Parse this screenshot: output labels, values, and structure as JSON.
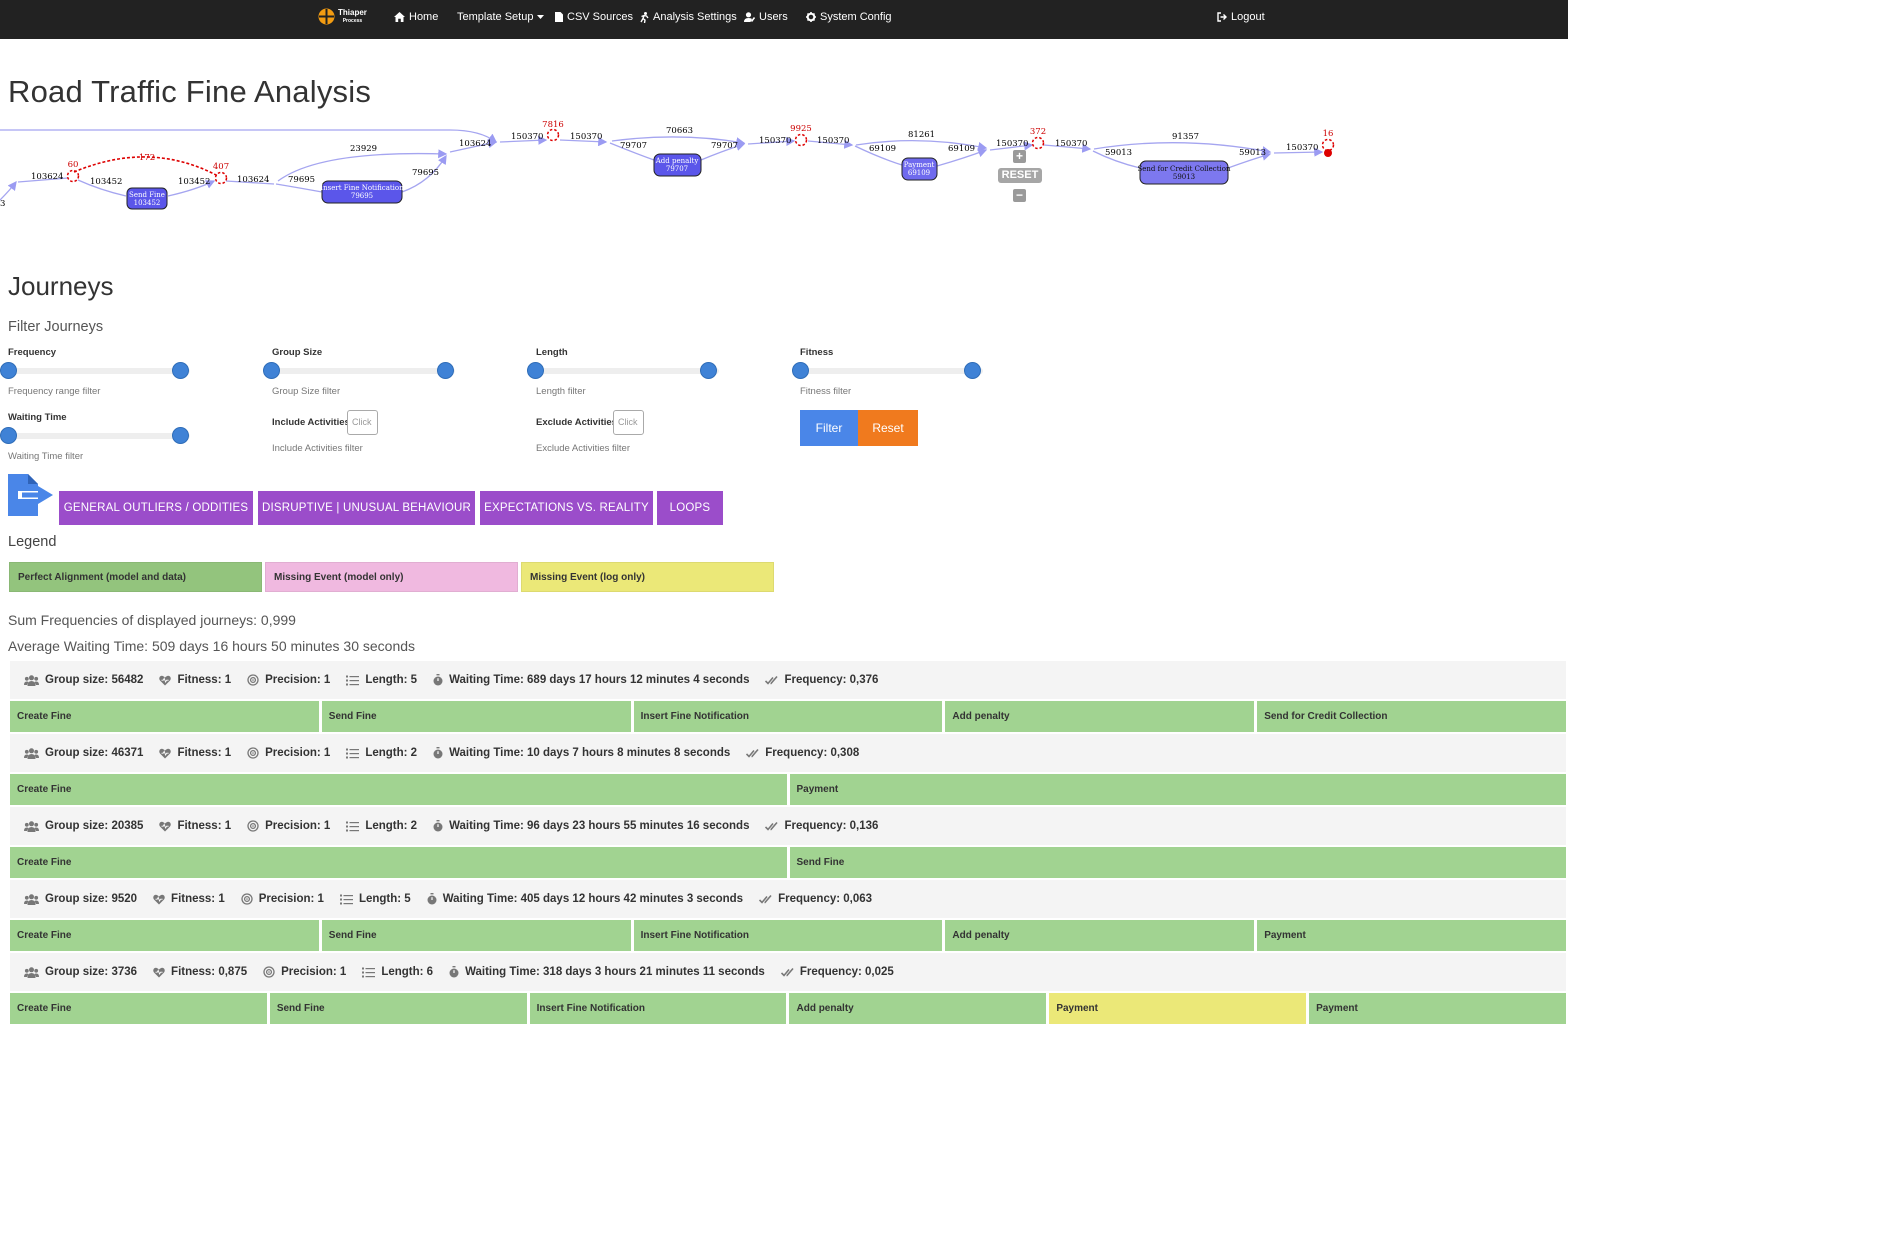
{
  "navbar": {
    "brand_name": "Thiaper",
    "brand_sub": "Process",
    "home": "Home",
    "template_setup": "Template Setup",
    "csv_sources": "CSV Sources",
    "analysis_settings": "Analysis Settings",
    "users": "Users",
    "system_config": "System Config",
    "logout": "Logout"
  },
  "page": {
    "title": "Road Traffic Fine Analysis"
  },
  "graph": {
    "nodes": [
      {
        "label": "Send Fine",
        "count": "103452"
      },
      {
        "label": "Insert Fine Notification",
        "count": "79695"
      },
      {
        "label": "Add penalty",
        "count": "79707"
      },
      {
        "label": "Payment",
        "count": "69109"
      },
      {
        "label": "Send for Credit Collection",
        "count": "59013"
      }
    ],
    "edge_labels": [
      "103624",
      "103452",
      "103452",
      "103624",
      "79695",
      "79695",
      "23929",
      "103624",
      "150370",
      "150370",
      "79707",
      "70663",
      "79707",
      "150370",
      "150370",
      "69109",
      "81261",
      "69109",
      "150370",
      "150370",
      "59013",
      "91357",
      "59013",
      "150370",
      "3"
    ],
    "event_counts": [
      "60",
      "172",
      "407",
      "7816",
      "9925",
      "372",
      "16"
    ],
    "reset_label": "RESET",
    "zoom_in": "+",
    "zoom_out": "−"
  },
  "journeys_section": {
    "title": "Journeys",
    "filter_heading": "Filter Journeys"
  },
  "filters": {
    "frequency": {
      "label": "Frequency",
      "help": "Frequency range filter",
      "range": [
        0,
        1
      ]
    },
    "group_size": {
      "label": "Group Size",
      "help": "Group Size filter",
      "range": [
        0,
        1
      ]
    },
    "length": {
      "label": "Length",
      "help": "Length filter",
      "range": [
        0,
        1
      ]
    },
    "fitness": {
      "label": "Fitness",
      "help": "Fitness filter",
      "range": [
        0,
        1
      ]
    },
    "waiting_time": {
      "label": "Waiting Time",
      "help": "Waiting Time filter",
      "range": [
        0,
        1
      ]
    },
    "include_activities": {
      "label": "Include Activities",
      "placeholder": "Click",
      "help": "Include Activities filter"
    },
    "exclude_activities": {
      "label": "Exclude Activities",
      "placeholder": "Click",
      "help": "Exclude Activities filter"
    },
    "filter_button": "Filter",
    "reset_button": "Reset"
  },
  "categories": [
    "GENERAL OUTLIERS / ODDITIES",
    "DISRUPTIVE | UNUSUAL BEHAVIOUR",
    "EXPECTATIONS VS. REALITY",
    "LOOPS"
  ],
  "legend": {
    "title": "Legend",
    "items": [
      {
        "label": "Perfect Alignment (model and data)",
        "color": "#93c47d"
      },
      {
        "label": "Missing Event (model only)",
        "color": "#f0b9e0"
      },
      {
        "label": "Missing Event (log only)",
        "color": "#ebe878"
      }
    ]
  },
  "stats": {
    "sum_frequencies": "Sum Frequencies of displayed journeys: 0,999",
    "avg_waiting": "Average Waiting Time: 509 days 16 hours 50 minutes 30 seconds"
  },
  "journeys": [
    {
      "group_size": "Group size: 56482",
      "fitness": "Fitness: 1",
      "precision": "Precision: 1",
      "length": "Length: 5",
      "waiting": "Waiting Time: 689 days 17 hours 12 minutes 4 seconds",
      "frequency": "Frequency: 0,376",
      "activities": [
        {
          "name": "Create Fine",
          "type": "both"
        },
        {
          "name": "Send Fine",
          "type": "both"
        },
        {
          "name": "Insert Fine Notification",
          "type": "both"
        },
        {
          "name": "Add penalty",
          "type": "both"
        },
        {
          "name": "Send for Credit Collection",
          "type": "both"
        }
      ]
    },
    {
      "group_size": "Group size: 46371",
      "fitness": "Fitness: 1",
      "precision": "Precision: 1",
      "length": "Length: 2",
      "waiting": "Waiting Time: 10 days 7 hours 8 minutes 8 seconds",
      "frequency": "Frequency: 0,308",
      "activities": [
        {
          "name": "Create Fine",
          "type": "both"
        },
        {
          "name": "Payment",
          "type": "both"
        }
      ]
    },
    {
      "group_size": "Group size: 20385",
      "fitness": "Fitness: 1",
      "precision": "Precision: 1",
      "length": "Length: 2",
      "waiting": "Waiting Time: 96 days 23 hours 55 minutes 16 seconds",
      "frequency": "Frequency: 0,136",
      "activities": [
        {
          "name": "Create Fine",
          "type": "both"
        },
        {
          "name": "Send Fine",
          "type": "both"
        }
      ]
    },
    {
      "group_size": "Group size: 9520",
      "fitness": "Fitness: 1",
      "precision": "Precision: 1",
      "length": "Length: 5",
      "waiting": "Waiting Time: 405 days 12 hours 42 minutes 3 seconds",
      "frequency": "Frequency: 0,063",
      "activities": [
        {
          "name": "Create Fine",
          "type": "both"
        },
        {
          "name": "Send Fine",
          "type": "both"
        },
        {
          "name": "Insert Fine Notification",
          "type": "both"
        },
        {
          "name": "Add penalty",
          "type": "both"
        },
        {
          "name": "Payment",
          "type": "both"
        }
      ]
    },
    {
      "group_size": "Group size: 3736",
      "fitness": "Fitness: 0,875",
      "precision": "Precision: 1",
      "length": "Length: 6",
      "waiting": "Waiting Time: 318 days 3 hours 21 minutes 11 seconds",
      "frequency": "Frequency: 0,025",
      "activities": [
        {
          "name": "Create Fine",
          "type": "both"
        },
        {
          "name": "Send Fine",
          "type": "both"
        },
        {
          "name": "Insert Fine Notification",
          "type": "both"
        },
        {
          "name": "Add penalty",
          "type": "both"
        },
        {
          "name": "Payment",
          "type": "log-only"
        },
        {
          "name": "Payment",
          "type": "both"
        }
      ]
    }
  ]
}
